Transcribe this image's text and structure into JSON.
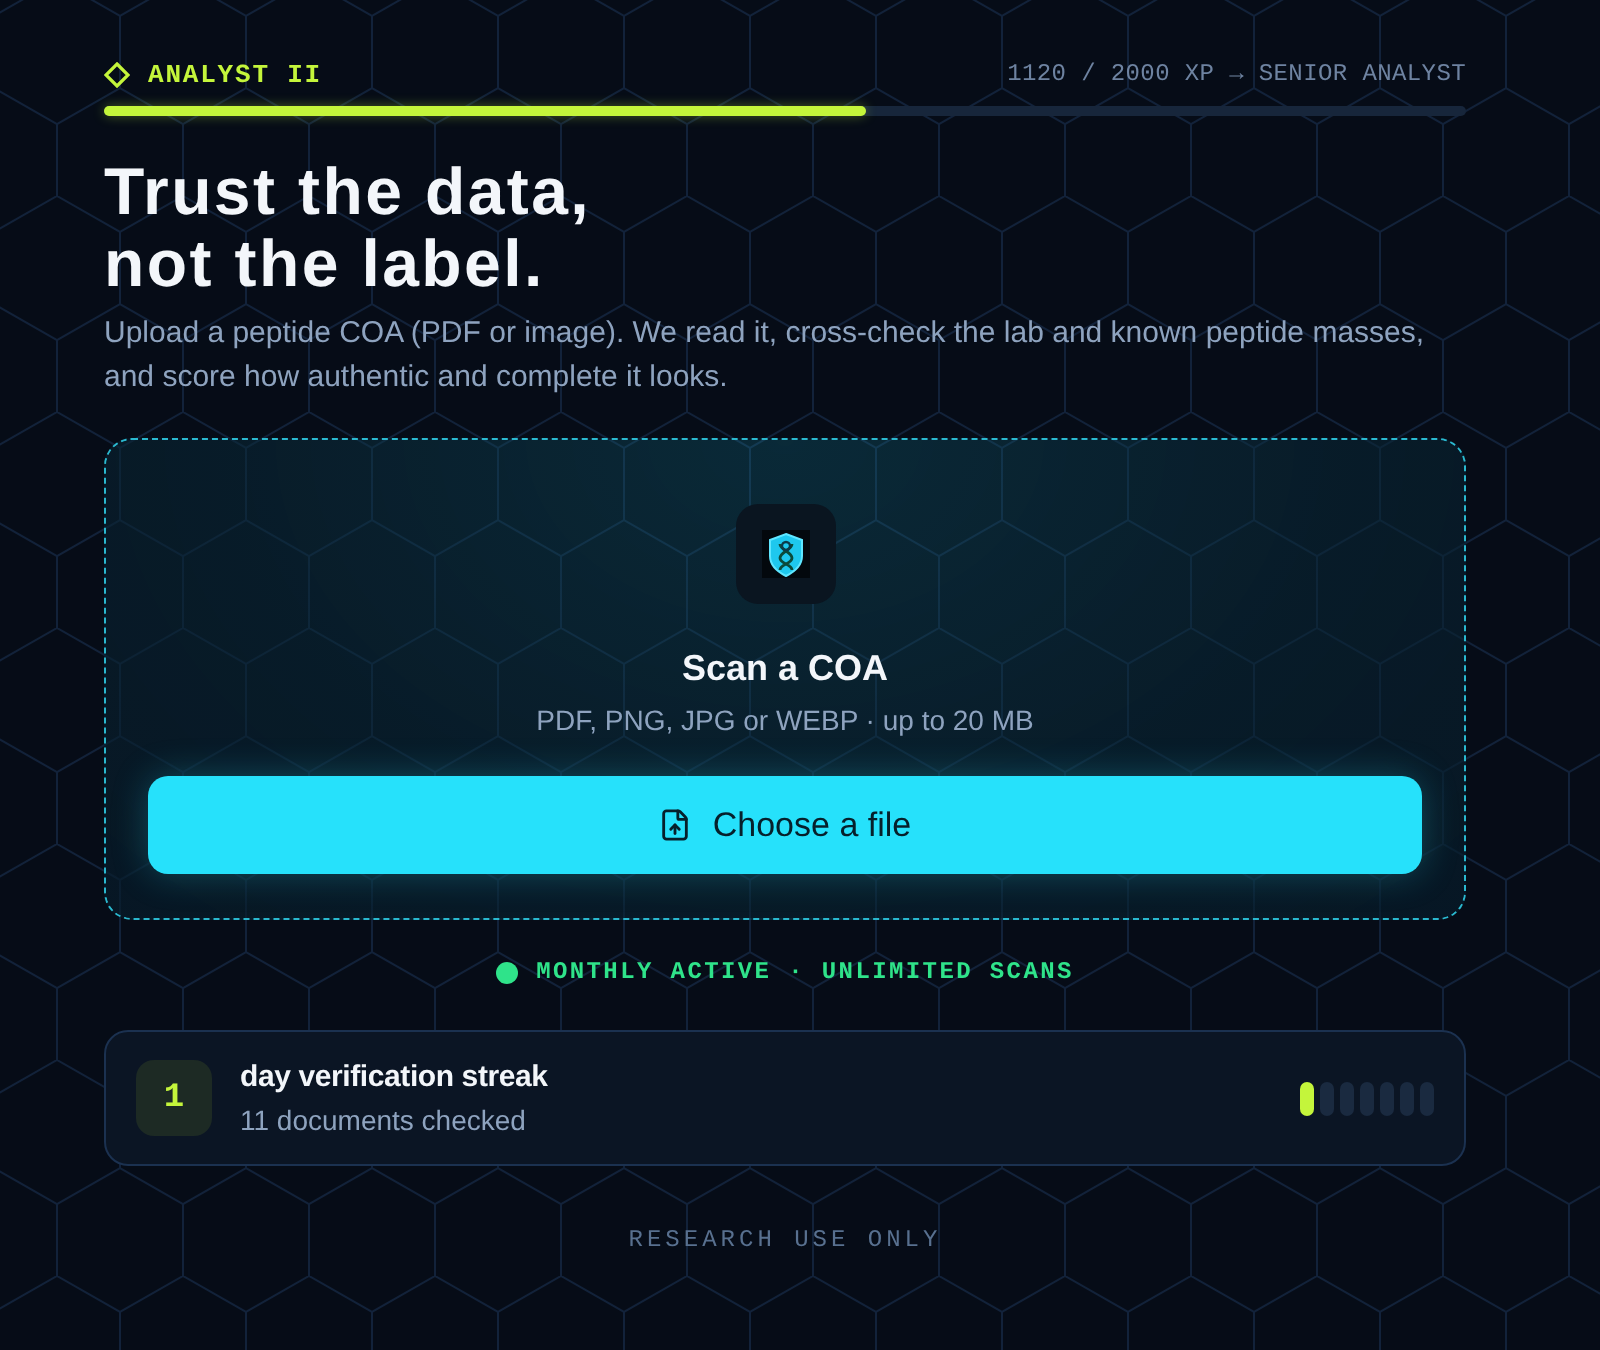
{
  "rank": {
    "title": "ANALYST II",
    "progress_text": "1120 / 2000 XP → SENIOR ANALYST",
    "level": 0.56
  },
  "hero": {
    "heading_lines": [
      "Trust the data,",
      "not the label."
    ],
    "description": "Upload a peptide COA (PDF or image). We read it, cross-check the lab and known peptide masses, and score how authentic and complete it looks."
  },
  "upload": {
    "title": "Scan a COA",
    "formats": "PDF, PNG, JPG or WEBP · up to 20 MB",
    "button": "Choose a file"
  },
  "plan_status": {
    "text": "MONTHLY ACTIVE · UNLIMITED SCANS",
    "active": true
  },
  "streak": {
    "count": "1",
    "title": "day verification streak",
    "subtitle": "11 documents checked",
    "days": [
      {
        "filled": true
      },
      {
        "filled": false
      },
      {
        "filled": false
      },
      {
        "filled": false
      },
      {
        "filled": false
      },
      {
        "filled": false
      },
      {
        "filled": false
      }
    ]
  },
  "footer": "RESEARCH USE ONLY"
}
